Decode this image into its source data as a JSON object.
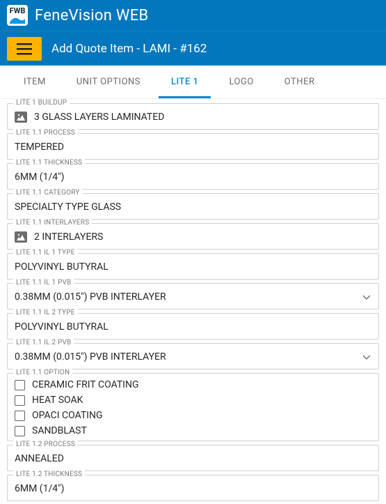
{
  "header": {
    "app_name": "FeneVision WEB",
    "logo_abbr": "FWB",
    "page_title": "Add Quote Item - LAMI - #162"
  },
  "tabs": [
    {
      "label": "ITEM",
      "active": false
    },
    {
      "label": "UNIT OPTIONS",
      "active": false
    },
    {
      "label": "LITE 1",
      "active": true
    },
    {
      "label": "LOGO",
      "active": false
    },
    {
      "label": "OTHER",
      "active": false
    }
  ],
  "fields": {
    "buildup": {
      "label": "LITE 1 BUILDUP",
      "value": "3 GLASS LAYERS LAMINATED"
    },
    "process_11": {
      "label": "LITE 1.1 PROCESS",
      "value": "TEMPERED"
    },
    "thickness_11": {
      "label": "LITE 1.1 THICKNESS",
      "value": "6MM (1/4\")"
    },
    "category_11": {
      "label": "LITE 1.1 CATEGORY",
      "value": "SPECIALTY TYPE GLASS"
    },
    "interlayers_11": {
      "label": "LITE 1.1 INTERLAYERS",
      "value": "2 INTERLAYERS"
    },
    "il1_type": {
      "label": "LITE 1.1 IL 1 TYPE",
      "value": "POLYVINYL BUTYRAL"
    },
    "il1_pvb": {
      "label": "LITE 1.1 IL 1 PVB",
      "value": "0.38MM (0.015\") PVB INTERLAYER"
    },
    "il2_type": {
      "label": "LITE 1.1 IL 2 TYPE",
      "value": "POLYVINYL BUTYRAL"
    },
    "il2_pvb": {
      "label": "LITE 1.1 IL 2 PVB",
      "value": "0.38MM (0.015\") PVB INTERLAYER"
    },
    "option_11": {
      "label": "LITE 1.1 OPTION",
      "options": [
        "CERAMIC FRIT COATING",
        "HEAT SOAK",
        "OPACI COATING",
        "SANDBLAST"
      ]
    },
    "process_12": {
      "label": "LITE 1.2 PROCESS",
      "value": "ANNEALED"
    },
    "thickness_12": {
      "label": "LITE 1.2 THICKNESS",
      "value": "6MM (1/4\")"
    }
  }
}
